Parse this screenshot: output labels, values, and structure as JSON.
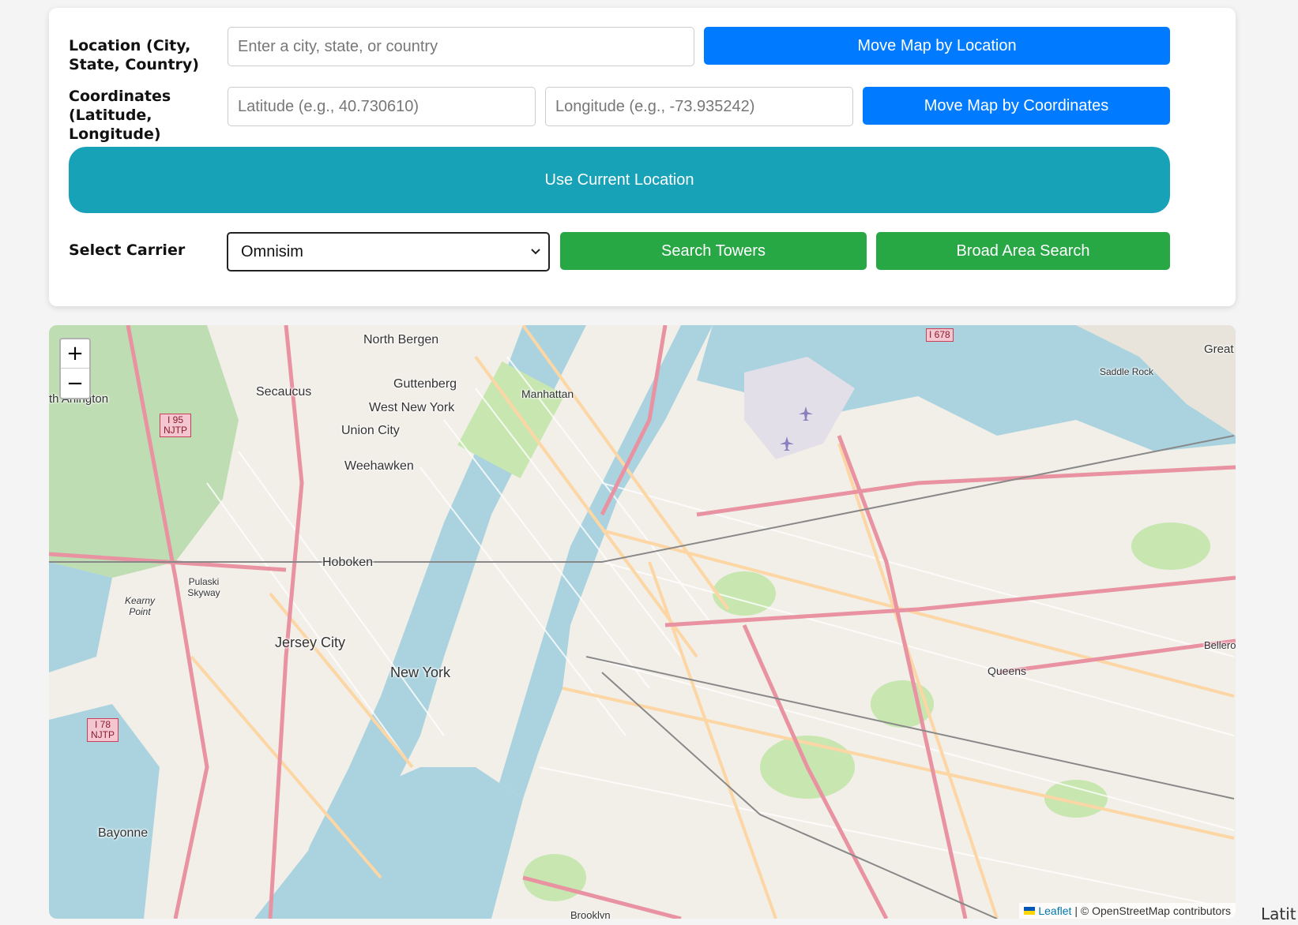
{
  "controls": {
    "location_label": "Location (City, State, Country)",
    "location_placeholder": "Enter a city, state, or country",
    "move_by_location": "Move Map by Location",
    "coordinates_label": "Coordinates (Latitude, Longitude)",
    "latitude_placeholder": "Latitude (e.g., 40.730610)",
    "longitude_placeholder": "Longitude (e.g., -73.935242)",
    "move_by_coordinates": "Move Map by Coordinates",
    "use_current_location": "Use Current Location",
    "carrier_label": "Select Carrier",
    "carrier_selected": "Omnisim",
    "search_towers": "Search Towers",
    "broad_area_search": "Broad Area Search"
  },
  "map": {
    "zoom_in": "+",
    "zoom_out": "−",
    "attribution_link": "Leaflet",
    "attribution_text": "| © OpenStreetMap contributors",
    "places": [
      {
        "name": "North Bergen"
      },
      {
        "name": "Guttenberg"
      },
      {
        "name": "West New York"
      },
      {
        "name": "Secaucus"
      },
      {
        "name": "Union City"
      },
      {
        "name": "Weehawken"
      },
      {
        "name": "Manhattan"
      },
      {
        "name": "Hoboken"
      },
      {
        "name": "Jersey City"
      },
      {
        "name": "New York"
      },
      {
        "name": "Queens"
      },
      {
        "name": "Bayonne"
      },
      {
        "name": "Saddle Rock"
      },
      {
        "name": "th Arlington"
      },
      {
        "name": "Great"
      },
      {
        "name": "Pulaski Skyway"
      },
      {
        "name": "Kearny Point"
      },
      {
        "name": "Bellero"
      },
      {
        "name": "Brooklyn"
      }
    ],
    "shields": [
      {
        "text": "I 95 NJTP"
      },
      {
        "text": "I 78 NJTP"
      },
      {
        "text": "I 678"
      }
    ],
    "colors": {
      "water": "#aad3df",
      "land": "#f2efe9",
      "park": "#c8e6b0",
      "motorway": "#e892a2",
      "primary": "#fcd6a4"
    }
  },
  "edge_text": "Latit"
}
